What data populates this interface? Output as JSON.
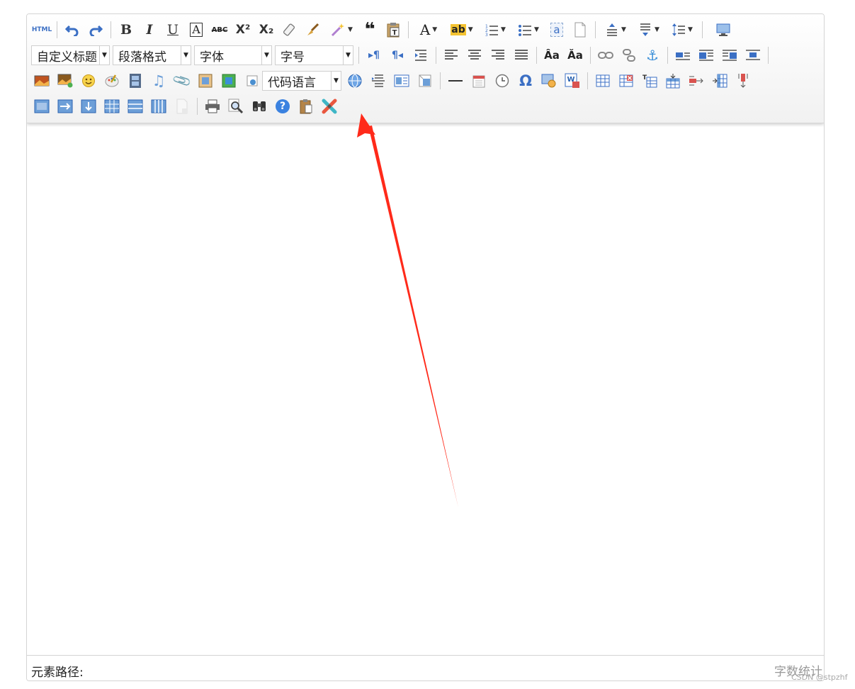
{
  "toolbar": {
    "html_label": "HTML",
    "bold_label": "B",
    "italic_label": "I",
    "underline_label": "U",
    "fontborder_label": "A",
    "strike_label": "ABC",
    "superscript_label": "X²",
    "subscript_label": "X₂",
    "blockquote_label": "❝",
    "forecolor_label": "A",
    "backcolor_label": "ab",
    "insertcode_label": "a",
    "custom_heading": "自定义标题",
    "paragraph_format": "段落格式",
    "font_family": "字体",
    "font_size": "字号",
    "code_language": "代码语言",
    "omega_label": "Ω",
    "help_label": "?",
    "accent_color": "#3b6fc4",
    "arrow_color": "#ff2a1a"
  },
  "status": {
    "element_path_label": "元素路径:",
    "word_count_label": "字数统计"
  },
  "watermark": "CSDN @stpzhf"
}
